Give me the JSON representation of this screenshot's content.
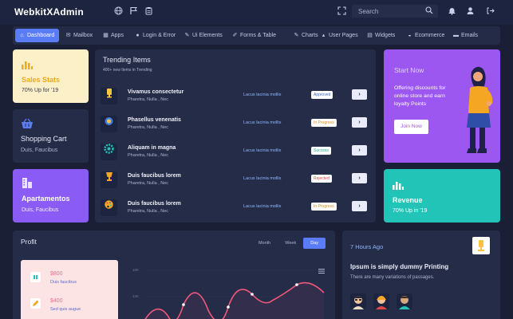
{
  "app": {
    "title": "WebkitXAdmin"
  },
  "header": {
    "search_placeholder": "Search"
  },
  "nav": {
    "items": [
      {
        "label": "Dashboard"
      },
      {
        "label": "Mailbox"
      },
      {
        "label": "Apps"
      },
      {
        "label": "Login & Error"
      },
      {
        "label": "Ui Elements"
      },
      {
        "label": "Forms & Table"
      },
      {
        "label": "Charts"
      },
      {
        "label": "User Pages"
      },
      {
        "label": "Widgets"
      },
      {
        "label": "Ecommerce"
      },
      {
        "label": "Emails"
      }
    ]
  },
  "cards": {
    "sales": {
      "title": "Sales Stats",
      "sub": "70% Up for '19"
    },
    "cart": {
      "title": "Shopping Cart",
      "sub": "Duis, Faucibus"
    },
    "apartments": {
      "title": "Apartamentos",
      "sub": "Duis, Faucibus"
    }
  },
  "trending": {
    "title": "Trending Items",
    "subtitle": "400+ new Items in Trending",
    "rows": [
      {
        "name": "Vivamus consectetur",
        "desc": "Pharetra, Nulla , Nec",
        "lacus": "Lacus lacinia mollis",
        "status": "Approved"
      },
      {
        "name": "Phasellus venenatis",
        "desc": "Pharetra, Nulla , Nec",
        "lacus": "Lacus lacinia mollis",
        "status": "In Progress"
      },
      {
        "name": "Aliquam in magna",
        "desc": "Pharetra, Nulla , Nec",
        "lacus": "Lacus lacinia mollis",
        "status": "Success"
      },
      {
        "name": "Duis faucibus lorem",
        "desc": "Pharetra, Nulla , Nec",
        "lacus": "Lacus lacinia mollis",
        "status": "Rejected"
      },
      {
        "name": "Duis faucibus lorem",
        "desc": "Pharetra, Nulla , Nec",
        "lacus": "Lacus lacinia mollis",
        "status": "In Progress"
      }
    ]
  },
  "start": {
    "title": "Start Now",
    "text": "Offering discounts for online store and earn loyalty Points",
    "button": "Join Now"
  },
  "revenue": {
    "title": "Revenue",
    "sub": "70% Up in '19"
  },
  "profit": {
    "title": "Profit",
    "tabs": [
      "Month",
      "Week",
      "Day"
    ],
    "mini": [
      {
        "value": "$800",
        "label": "Duis faucibus"
      },
      {
        "value": "$400",
        "label": "Sed quis augue"
      }
    ],
    "axis": [
      "16K",
      "12K"
    ]
  },
  "activity": {
    "time": "7 Hours Ago",
    "title": "Ipsum is simply dummy Printing",
    "text": "There are many variations of passages."
  },
  "colors": {
    "accent": "#5b7cf7",
    "sales_card": "#fcf0c8",
    "apartments_card": "#8a5cf5",
    "start_card": "#9b57ef",
    "revenue_card": "#23c4b8",
    "mini_card": "#fde4e4",
    "line": "#f0577a"
  }
}
